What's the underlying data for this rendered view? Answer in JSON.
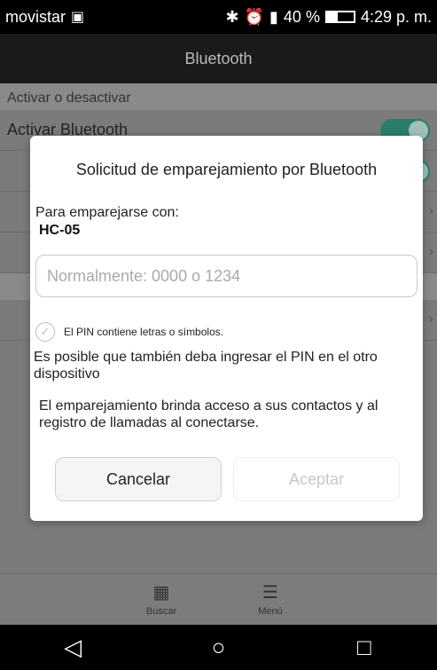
{
  "status_bar": {
    "carrier": "movistar",
    "battery_percent_text": "40 %",
    "battery_level": 0.4,
    "time": "4:29 p. m."
  },
  "title_bar": {
    "title": "Bluetooth"
  },
  "settings": {
    "section_header": "Activar o desactivar",
    "row1_label": "Activar Bluetooth"
  },
  "dialog": {
    "title": "Solicitud de emparejamiento por Bluetooth",
    "pair_with_label": "Para emparejarse con:",
    "device_name": "HC-05",
    "pin_placeholder": "Normalmente: 0000 o 1234",
    "pin_value": "",
    "checkbox_label": "El PIN contiene letras o símbolos.",
    "note_pin": "Es posible que también deba ingresar el PIN en el otro dispositivo",
    "note_access": "El emparejamiento brinda acceso a sus contactos y al registro de llamadas al conectarse.",
    "cancel_label": "Cancelar",
    "accept_label": "Aceptar"
  },
  "bottom_tabs": {
    "search_label": "Buscar",
    "menu_label": "Menú"
  },
  "colors": {
    "toggle_on": "#2a7d6b",
    "accept_disabled_text": "#c7c7c7"
  }
}
